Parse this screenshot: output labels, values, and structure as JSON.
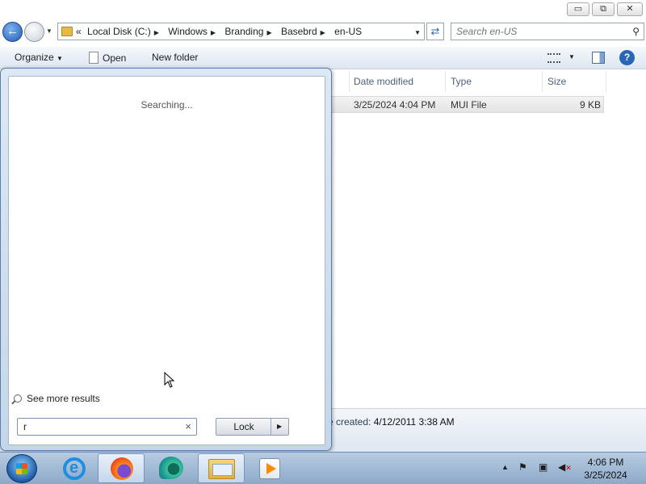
{
  "window": {
    "controls": {
      "minimize": "▭",
      "maximize": "⧉",
      "close": "✕"
    }
  },
  "address": {
    "overflow": "«",
    "crumbs": [
      "Local Disk (C:)",
      "Windows",
      "Branding",
      "Basebrd",
      "en-US"
    ],
    "search_placeholder": "Search en-US"
  },
  "toolbar": {
    "organize": "Organize",
    "open": "Open",
    "new_folder": "New folder"
  },
  "columns": {
    "date_modified": "Date modified",
    "type": "Type",
    "size": "Size"
  },
  "file_row": {
    "date": "3/25/2024 4:04 PM",
    "type": "MUI File",
    "size": "9 KB"
  },
  "details": {
    "label": "e created:",
    "value": "4/12/2011 3:38 AM"
  },
  "start_menu": {
    "status": "Searching...",
    "see_more": "See more results",
    "search_value": "r",
    "clear": "×",
    "power_button": "Lock"
  },
  "taskbar": {
    "time": "4:06 PM",
    "date": "3/25/2024",
    "apps": [
      "internet-explorer",
      "firefox",
      "edge",
      "windows-explorer",
      "media-player"
    ]
  }
}
